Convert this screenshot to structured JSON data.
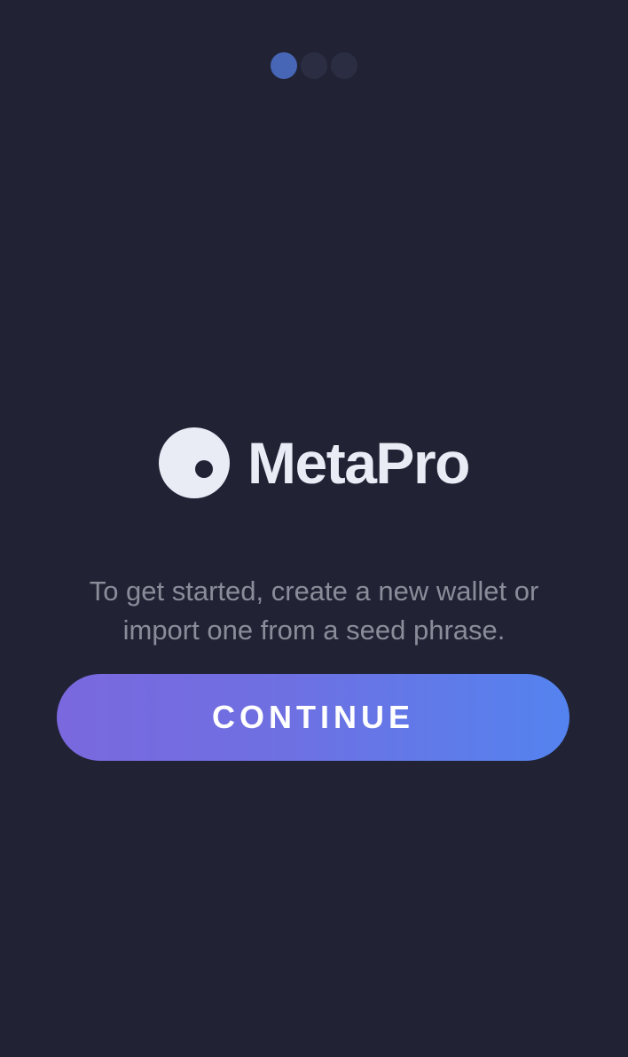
{
  "onboarding": {
    "page_indicator": {
      "total": 3,
      "current": 1
    },
    "brand": {
      "name": "MetaPro",
      "logo_icon": "metapro-logo-icon"
    },
    "subtitle": "To get started, create a new wallet or import one from a seed phrase.",
    "continue_label": "CONTINUE"
  },
  "colors": {
    "background": "#212335",
    "dot_active": "#4866b6",
    "dot_inactive": "#2b2d42",
    "brand_text": "#e9ebf5",
    "subtitle_text": "#8a8c99",
    "button_gradient_start": "#7a68de",
    "button_gradient_end": "#5483ef"
  }
}
